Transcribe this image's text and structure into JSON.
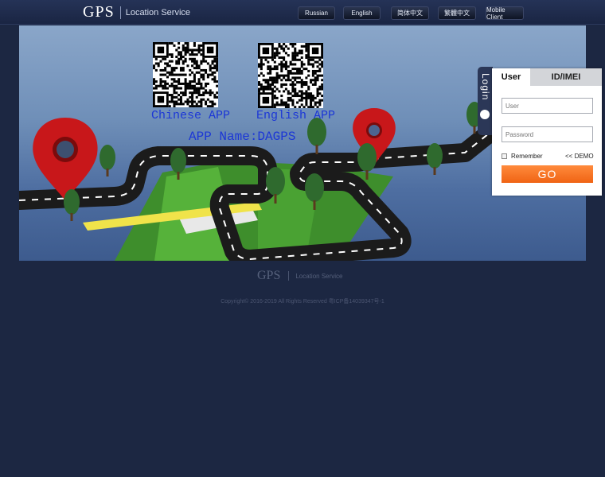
{
  "header": {
    "logo_main": "GPS",
    "logo_sub": "Location Service",
    "languages": [
      "Russian",
      "English",
      "简体中文",
      "繁體中文",
      "Mobile Client"
    ]
  },
  "banner": {
    "qr_chinese_label": "Chinese APP",
    "qr_english_label": "English APP",
    "app_name": "APP Name:DAGPS"
  },
  "login": {
    "tab_label": "Login",
    "tabs": [
      "User",
      "ID/IMEI"
    ],
    "user_placeholder": "User",
    "password_placeholder": "Password",
    "remember_label": "Remember",
    "demo_link": "<< DEMO",
    "go_label": "GO"
  },
  "footer": {
    "logo_main": "GPS",
    "logo_sub": "Location Service",
    "copyright": "Copyright© 2016-2019 All Rights Reserved  粤ICP备14039347号-1"
  },
  "colors": {
    "page_bg": "#1c2742",
    "accent_orange": "#f06414",
    "qr_label_blue": "#1c37d6"
  }
}
